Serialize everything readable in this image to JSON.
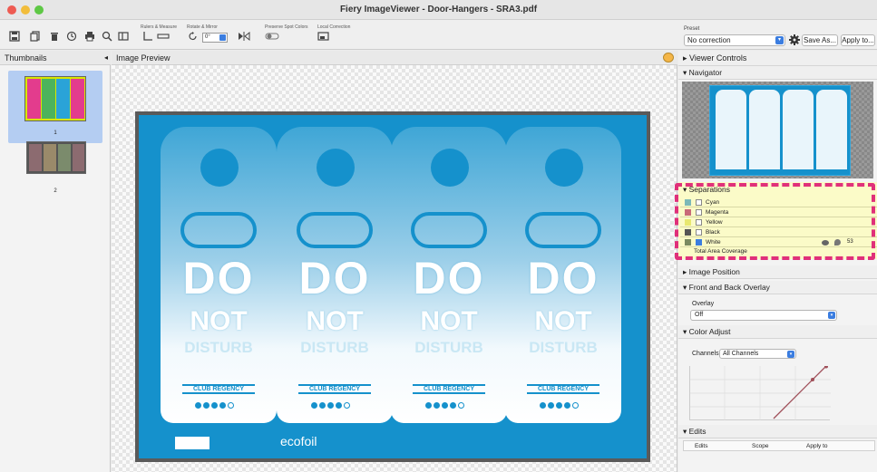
{
  "window": {
    "title": "Fiery ImageViewer - Door-Hangers - SRA3.pdf"
  },
  "toolbar": {
    "rulers_label": "Rulers & Measure",
    "rotate_label": "Rotate & Mirror",
    "rotate_value": "0°",
    "spot_label": "Preserve Spot Colors",
    "local_label": "Local Correction",
    "preset_label": "Preset",
    "preset_value": "No correction",
    "save_as": "Save As...",
    "apply_to": "Apply to..."
  },
  "thumbnails": {
    "header": "Thumbnails",
    "pages": [
      {
        "number": "1"
      },
      {
        "number": "2"
      }
    ]
  },
  "preview": {
    "header": "Image Preview",
    "hanger_text": {
      "line1": "DO",
      "line2": "NOT",
      "line3": "DISTURB",
      "brand": "CLUB REGENCY"
    },
    "footer_logo": "ecofoil",
    "bg_color": "#1591cc"
  },
  "right_panel": {
    "viewer_controls": "Viewer Controls",
    "navigator": "Navigator",
    "separations": {
      "title": "Separations",
      "rows": [
        {
          "name": "Cyan",
          "color": "#7cb8b8",
          "checked": false
        },
        {
          "name": "Magenta",
          "color": "#c86a78",
          "checked": false
        },
        {
          "name": "Yellow",
          "color": "#e8e870",
          "checked": false
        },
        {
          "name": "Black",
          "color": "#555555",
          "checked": false
        },
        {
          "name": "White",
          "color": "#7a8a60",
          "checked": true,
          "value": "53"
        }
      ],
      "total": "Total Area Coverage"
    },
    "image_position": "Image Position",
    "overlay_section": "Front and Back Overlay",
    "overlay_label": "Overlay",
    "overlay_value": "Off",
    "color_adjust": "Color Adjust",
    "channels_label": "Channels:",
    "channels_value": "All Channels",
    "edits": "Edits",
    "edits_cols": [
      "Edits",
      "Scope",
      "Apply to"
    ]
  },
  "colors": {
    "accent": "#3b7de0",
    "highlight": "#e0307a",
    "sep_bg": "#fbfbc8"
  }
}
